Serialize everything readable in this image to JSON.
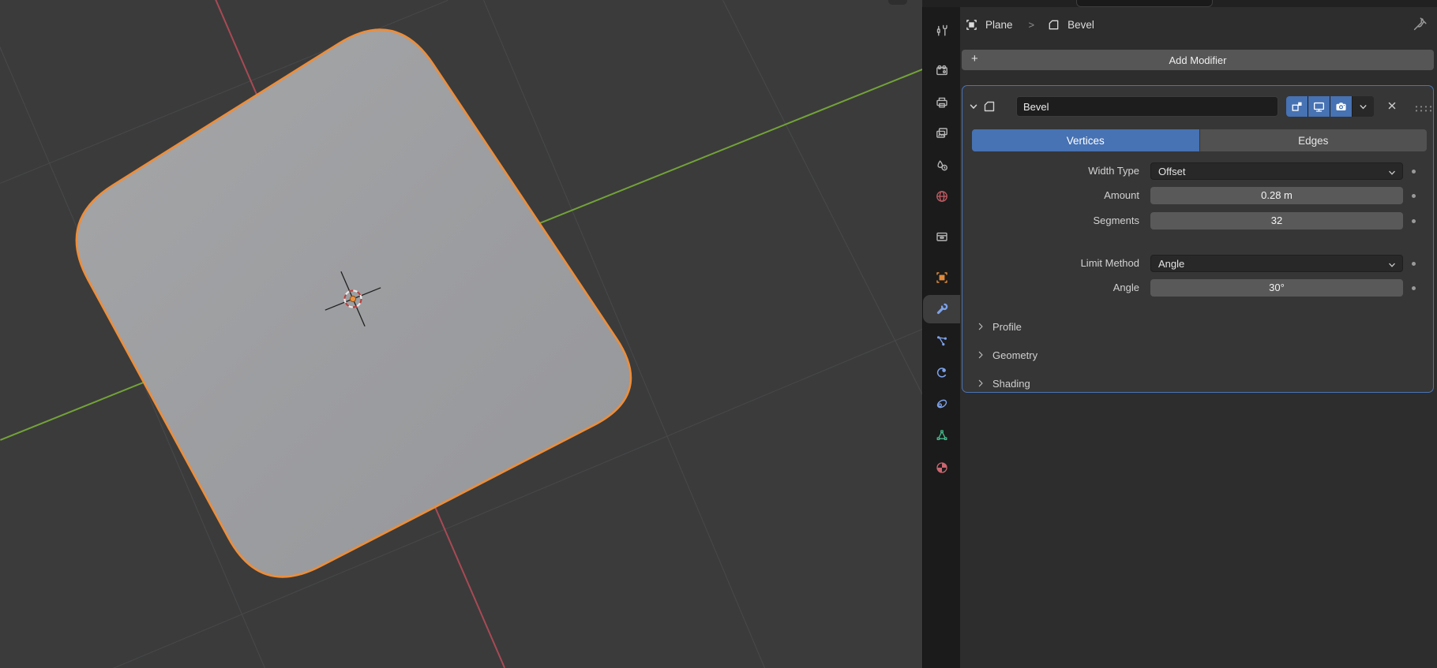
{
  "window": {
    "background": "#2d2d2d",
    "accent_blue": "#4772b3"
  },
  "viewport": {
    "background": "#3b3b3b",
    "plane_fill": "#9fa0a2",
    "selection_outline_color": "#ee8d38",
    "axis_x_color": "#a84a55",
    "axis_y_color": "#73a338",
    "grid_line_color": "#48494b",
    "cursor": {
      "ring_red": "#b5403e",
      "ring_white": "#e8e8e8",
      "origin_dot": "#ec9140"
    }
  },
  "icon_bar": {
    "icons": [
      "tool-icon",
      "render-icon",
      "output-icon",
      "view-layer-icon",
      "scene-icon",
      "world-icon",
      "collection-icon",
      "object-icon",
      "modifiers-wrench-icon",
      "particles-icon",
      "physics-icon",
      "constraints-icon",
      "object-data-icon",
      "material-icon"
    ],
    "active_tab": "modifiers"
  },
  "breadcrumb": {
    "object": "Plane",
    "separator": ">",
    "modifier": "Bevel"
  },
  "add_modifier": {
    "label": "Add Modifier",
    "plus": "+"
  },
  "modifier": {
    "name": "Bevel",
    "header_icons": [
      "edit-mode-toggle-icon",
      "viewport-display-toggle-icon",
      "render-display-toggle-icon",
      "extras-chevron-icon",
      "close-icon",
      "drag-grip-icon"
    ],
    "affect_tabs": [
      {
        "label": "Vertices",
        "active": true
      },
      {
        "label": "Edges",
        "active": false
      }
    ],
    "rows": [
      {
        "label": "Width Type",
        "value": "Offset",
        "control": "dropdown"
      },
      {
        "label": "Amount",
        "value": "0.28 m",
        "control": "slider"
      },
      {
        "label": "Segments",
        "value": "32",
        "control": "slider"
      },
      {
        "label": "Limit Method",
        "value": "Angle",
        "control": "dropdown"
      },
      {
        "label": "Angle",
        "value": "30°",
        "control": "slider"
      }
    ],
    "sections": [
      {
        "label": "Profile"
      },
      {
        "label": "Geometry"
      },
      {
        "label": "Shading"
      }
    ]
  }
}
